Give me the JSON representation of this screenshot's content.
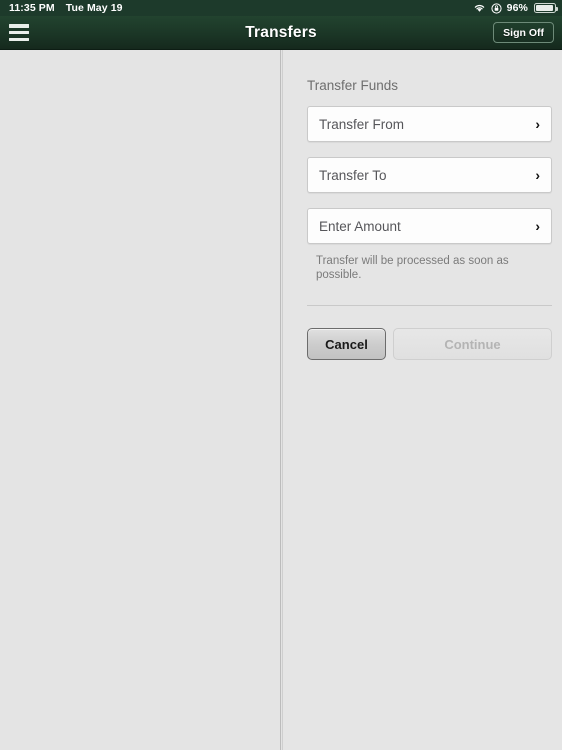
{
  "statusbar": {
    "time": "11:35 PM",
    "date": "Tue May 19",
    "wifi_icon": "wifi-icon",
    "lock_icon": "rotation-lock-icon",
    "battery_percent": "96%",
    "battery_icon": "battery-icon"
  },
  "navbar": {
    "menu_icon": "hamburger-menu-icon",
    "title": "Transfers",
    "signoff_label": "Sign Off"
  },
  "form": {
    "section_title": "Transfer Funds",
    "fields": [
      {
        "label": "Transfer From",
        "chevron": "›",
        "icon": "chevron-right-icon"
      },
      {
        "label": "Transfer To",
        "chevron": "›",
        "icon": "chevron-right-icon"
      },
      {
        "label": "Enter Amount",
        "chevron": "›",
        "icon": "chevron-right-icon"
      }
    ],
    "note": "Transfer will be processed as soon as possible.",
    "cancel_label": "Cancel",
    "continue_label": "Continue"
  },
  "colors": {
    "navbar_green": "#1d3a2b",
    "page_background": "#e4e4e4",
    "field_background": "#fdfdfd",
    "disabled_text": "#b4b4b4"
  }
}
